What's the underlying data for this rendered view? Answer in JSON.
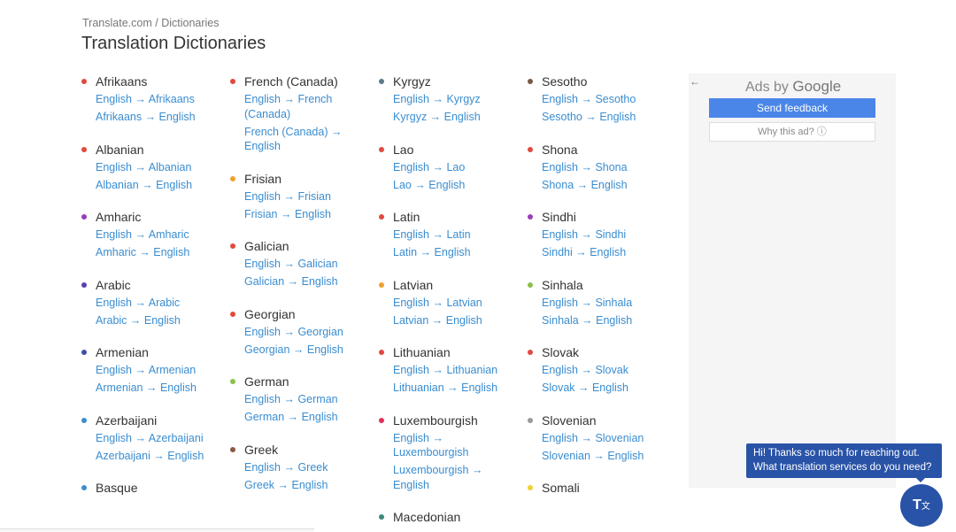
{
  "breadcrumb": {
    "site": "Translate.com",
    "separator": "/",
    "current": "Dictionaries"
  },
  "title": "Translation Dictionaries",
  "columns": [
    [
      {
        "name": "Afrikaans",
        "color": "#e04a3f",
        "links": [
          "English → Afrikaans",
          "Afrikaans → English"
        ]
      },
      {
        "name": "Albanian",
        "color": "#e04a3f",
        "links": [
          "English → Albanian",
          "Albanian → English"
        ]
      },
      {
        "name": "Amharic",
        "color": "#9b3db8",
        "links": [
          "English → Amharic",
          "Amharic → English"
        ]
      },
      {
        "name": "Arabic",
        "color": "#5a3fb0",
        "links": [
          "English → Arabic",
          "Arabic → English"
        ]
      },
      {
        "name": "Armenian",
        "color": "#3d4fa8",
        "links": [
          "English → Armenian",
          "Armenian → English"
        ]
      },
      {
        "name": "Azerbaijani",
        "color": "#3a8dd0",
        "links": [
          "English → Azerbaijani",
          "Azerbaijani → English"
        ]
      },
      {
        "name": "Basque",
        "color": "#3a8dd0",
        "links": []
      }
    ],
    [
      {
        "name": "French (Canada)",
        "color": "#e04a3f",
        "links": [
          "English → French (Canada)",
          "French (Canada) → English"
        ]
      },
      {
        "name": "Frisian",
        "color": "#f0a030",
        "links": [
          "English → Frisian",
          "Frisian → English"
        ]
      },
      {
        "name": "Galician",
        "color": "#e04a3f",
        "links": [
          "English → Galician",
          "Galician → English"
        ]
      },
      {
        "name": "Georgian",
        "color": "#e04a3f",
        "links": [
          "English → Georgian",
          "Georgian → English"
        ]
      },
      {
        "name": "German",
        "color": "#8cc04a",
        "links": [
          "English → German",
          "German → English"
        ]
      },
      {
        "name": "Greek",
        "color": "#8a5a44",
        "links": [
          "English → Greek",
          "Greek → English"
        ]
      }
    ],
    [
      {
        "name": "Kyrgyz",
        "color": "#5a7a8a",
        "links": [
          "English → Kyrgyz",
          "Kyrgyz → English"
        ]
      },
      {
        "name": "Lao",
        "color": "#e04a3f",
        "links": [
          "English → Lao",
          "Lao → English"
        ]
      },
      {
        "name": "Latin",
        "color": "#e04a3f",
        "links": [
          "English → Latin",
          "Latin → English"
        ]
      },
      {
        "name": "Latvian",
        "color": "#f0a030",
        "links": [
          "English → Latvian",
          "Latvian → English"
        ]
      },
      {
        "name": "Lithuanian",
        "color": "#e04a3f",
        "links": [
          "English → Lithuanian",
          "Lithuanian → English"
        ]
      },
      {
        "name": "Luxembourgish",
        "color": "#e0305a",
        "links": [
          "English → Luxembourgish",
          "Luxembourgish → English"
        ]
      },
      {
        "name": "Macedonian",
        "color": "#3a8a7a",
        "links": []
      }
    ],
    [
      {
        "name": "Sesotho",
        "color": "#7a5a44",
        "links": [
          "English → Sesotho",
          "Sesotho → English"
        ]
      },
      {
        "name": "Shona",
        "color": "#e04a3f",
        "links": [
          "English → Shona",
          "Shona → English"
        ]
      },
      {
        "name": "Sindhi",
        "color": "#9b3db8",
        "links": [
          "English → Sindhi",
          "Sindhi → English"
        ]
      },
      {
        "name": "Sinhala",
        "color": "#8cc04a",
        "links": [
          "English → Sinhala",
          "Sinhala → English"
        ]
      },
      {
        "name": "Slovak",
        "color": "#e04a3f",
        "links": [
          "English → Slovak",
          "Slovak → English"
        ]
      },
      {
        "name": "Slovenian",
        "color": "#999999",
        "links": [
          "English → Slovenian",
          "Slovenian → English"
        ]
      },
      {
        "name": "Somali",
        "color": "#f0d030",
        "links": []
      }
    ]
  ],
  "ad": {
    "back_icon": "arrow-left-icon",
    "ads_by": "Ads by",
    "google": "Google",
    "send_feedback": "Send feedback",
    "why_this_ad": "Why this ad? ⓘ"
  },
  "chat": {
    "message_line1": "Hi! Thanks so much for reaching out.",
    "message_line2": "What translation services do you need?",
    "icon": "translate-icon",
    "icon_text": "T",
    "icon_sub": "文"
  }
}
